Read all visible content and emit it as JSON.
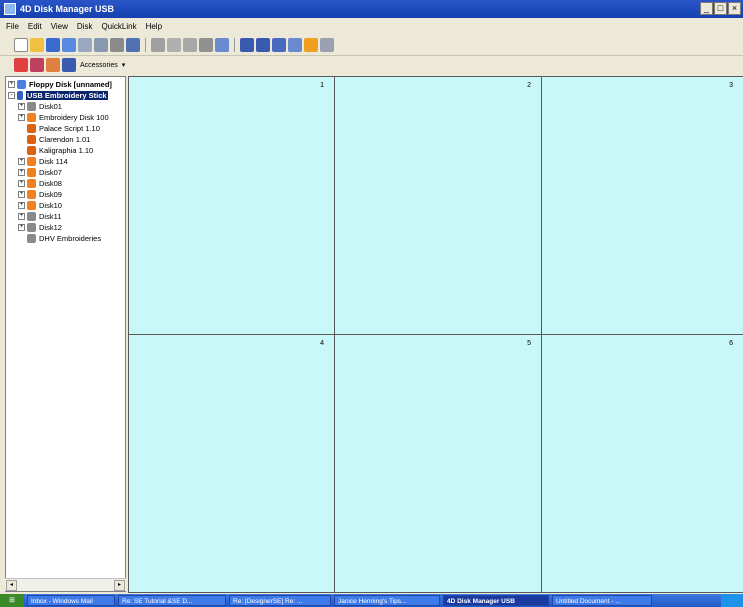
{
  "window": {
    "title": "4D Disk Manager USB",
    "controls": [
      "_",
      "□",
      "×"
    ]
  },
  "menu": [
    "File",
    "Edit",
    "View",
    "Disk",
    "QuickLink",
    "Help"
  ],
  "toolbar2": {
    "accessories_label": "Accessories"
  },
  "tree": [
    {
      "label": "Floppy Disk [unnamed]",
      "bold": true,
      "selected": false,
      "icon": "floppy",
      "level": 0,
      "expander": "+"
    },
    {
      "label": "USB Embroidery Stick",
      "bold": true,
      "selected": true,
      "icon": "usb",
      "level": 0,
      "expander": "-"
    },
    {
      "label": "Disk01",
      "icon": "gray",
      "level": 1,
      "expander": "+"
    },
    {
      "label": "Embroidery Disk 100",
      "icon": "orange",
      "level": 1,
      "expander": "+"
    },
    {
      "label": "Palace Script  1.10",
      "icon": "font",
      "level": 1,
      "expander": ""
    },
    {
      "label": "Clarendon  1.01",
      "icon": "font",
      "level": 1,
      "expander": ""
    },
    {
      "label": "Kaligraphia  1.10",
      "icon": "font",
      "level": 1,
      "expander": ""
    },
    {
      "label": "Disk 114",
      "icon": "orange",
      "level": 1,
      "expander": "+"
    },
    {
      "label": "Disk07",
      "icon": "orange",
      "level": 1,
      "expander": "+"
    },
    {
      "label": "Disk08",
      "icon": "orange",
      "level": 1,
      "expander": "+"
    },
    {
      "label": "Disk09",
      "icon": "orange",
      "level": 1,
      "expander": "+"
    },
    {
      "label": "Disk10",
      "icon": "orange",
      "level": 1,
      "expander": "+"
    },
    {
      "label": "Disk11",
      "icon": "gray",
      "level": 1,
      "expander": "+"
    },
    {
      "label": "Disk12",
      "icon": "gray",
      "level": 1,
      "expander": "+"
    },
    {
      "label": "DHV Embroideries",
      "icon": "gray",
      "level": 1,
      "expander": ""
    }
  ],
  "grid": {
    "cells": [
      "1",
      "2",
      "3",
      "4",
      "5",
      "6"
    ],
    "background": "#c8f8f8"
  },
  "taskbar": {
    "start": "",
    "tasks": [
      {
        "label": "Inbox - Windows Mail",
        "active": false
      },
      {
        "label": "Re: SE Tutorial &SE D...",
        "active": false
      },
      {
        "label": "Re: [DesignerSE] Re: ...",
        "active": false
      },
      {
        "label": "Janice Henning's Tips...",
        "active": false
      },
      {
        "label": "4D Disk Manager USB",
        "active": true
      },
      {
        "label": "Untitled Document - ...",
        "active": false
      }
    ]
  }
}
